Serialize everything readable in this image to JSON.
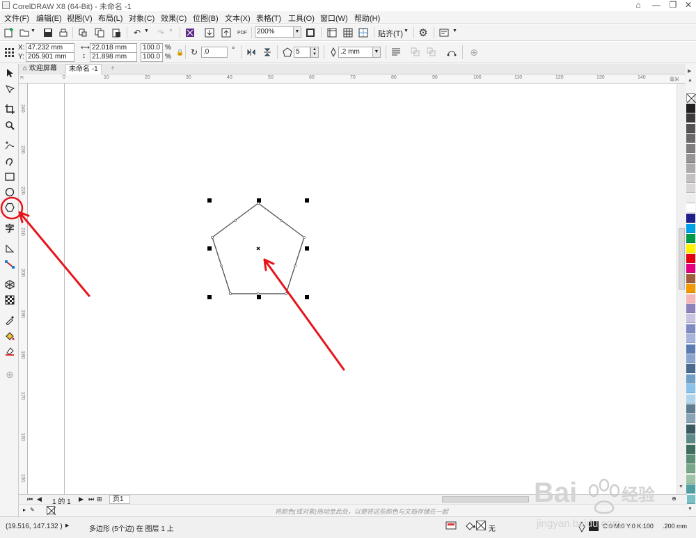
{
  "window": {
    "title": "CorelDRAW X8 (64-Bit) - 未命名 -1"
  },
  "menu": [
    {
      "id": "file",
      "label": "文件(F)"
    },
    {
      "id": "edit",
      "label": "编辑(E)"
    },
    {
      "id": "view",
      "label": "视图(V)"
    },
    {
      "id": "layout",
      "label": "布局(L)"
    },
    {
      "id": "object",
      "label": "对象(C)"
    },
    {
      "id": "effects",
      "label": "效果(C)"
    },
    {
      "id": "bitmaps",
      "label": "位图(B)"
    },
    {
      "id": "text",
      "label": "文本(X)"
    },
    {
      "id": "table",
      "label": "表格(T)"
    },
    {
      "id": "tools",
      "label": "工具(O)"
    },
    {
      "id": "window",
      "label": "窗口(W)"
    },
    {
      "id": "help",
      "label": "帮助(H)"
    }
  ],
  "toolbar": {
    "zoom_value": "200%",
    "snap_label": "贴齐(T)",
    "pdf_label": "PDF"
  },
  "propbar": {
    "x_label": "X:",
    "x_value": "47.232 mm",
    "y_label": "Y:",
    "y_value": "205.901 mm",
    "width_value": "22.018 mm",
    "height_value": "21.898 mm",
    "scale_x": "100.0",
    "scale_y": "100.0",
    "percent": "%",
    "angle_value": ".0",
    "degree": "°",
    "sides_value": "5",
    "outline_value": ".2 mm"
  },
  "tabs": {
    "welcome": "欢迎屏幕",
    "document": "未命名 -1"
  },
  "ruler": {
    "h_ticks": [
      "0",
      "10",
      "20",
      "30",
      "40",
      "50",
      "60",
      "70",
      "80",
      "90",
      "100",
      "110",
      "120",
      "130",
      "140"
    ],
    "h_unit": "毫米",
    "v_ticks": [
      "240",
      "230",
      "220",
      "210",
      "200",
      "190",
      "180",
      "170",
      "160",
      "150"
    ]
  },
  "pagebar": {
    "page_count": "1 的 1",
    "page_tab": "页1"
  },
  "docpalette": {
    "hint": "将颜色(或对象)拖动至此处，以便将这些颜色与文档存储在一起"
  },
  "status": {
    "coords": "(19.516, 147.132 )",
    "selection": "多边形 (5个边) 在 图层 1 上",
    "fill_none": "无",
    "outline_color": "C:0 M:0 Y:0 K:100",
    "outline_width": ".200 mm"
  },
  "palette_colors": [
    "#231f20",
    "#3d3b3c",
    "#555354",
    "#6a6869",
    "#807e7f",
    "#969495",
    "#acaaab",
    "#c2c0c1",
    "#d8d6d7",
    "#ededed",
    "#ffffff",
    "#1d2088",
    "#00a0e9",
    "#009944",
    "#fff100",
    "#e60012",
    "#e4007f",
    "#a05f3a",
    "#f39800",
    "#f7b6b8",
    "#8f82bc",
    "#c9c4e2",
    "#7e8bc2",
    "#a6b3da",
    "#5b7bb2",
    "#8aa6cf",
    "#4a6b91",
    "#6ea0c8",
    "#89c3eb",
    "#b0d4ea",
    "#5e7d8e",
    "#87a5b5",
    "#3b5b63",
    "#5f8a8b",
    "#3e6e5e",
    "#5a8f76",
    "#77a88a",
    "#9fc3a6",
    "#4fa0a3",
    "#79c1c4"
  ],
  "colors": {
    "annotation": "#e8141c",
    "selection_handle": "#000000",
    "shape_stroke": "#5a5a5a",
    "chrome_bg": "#f4f4f4"
  },
  "icons": {
    "pick": "pick-tool-icon",
    "polygon": "polygon-tool-icon"
  },
  "watermark": {
    "brand": "Bai",
    "brand_cn": "经验",
    "url": "jingyan.baidu.com"
  }
}
